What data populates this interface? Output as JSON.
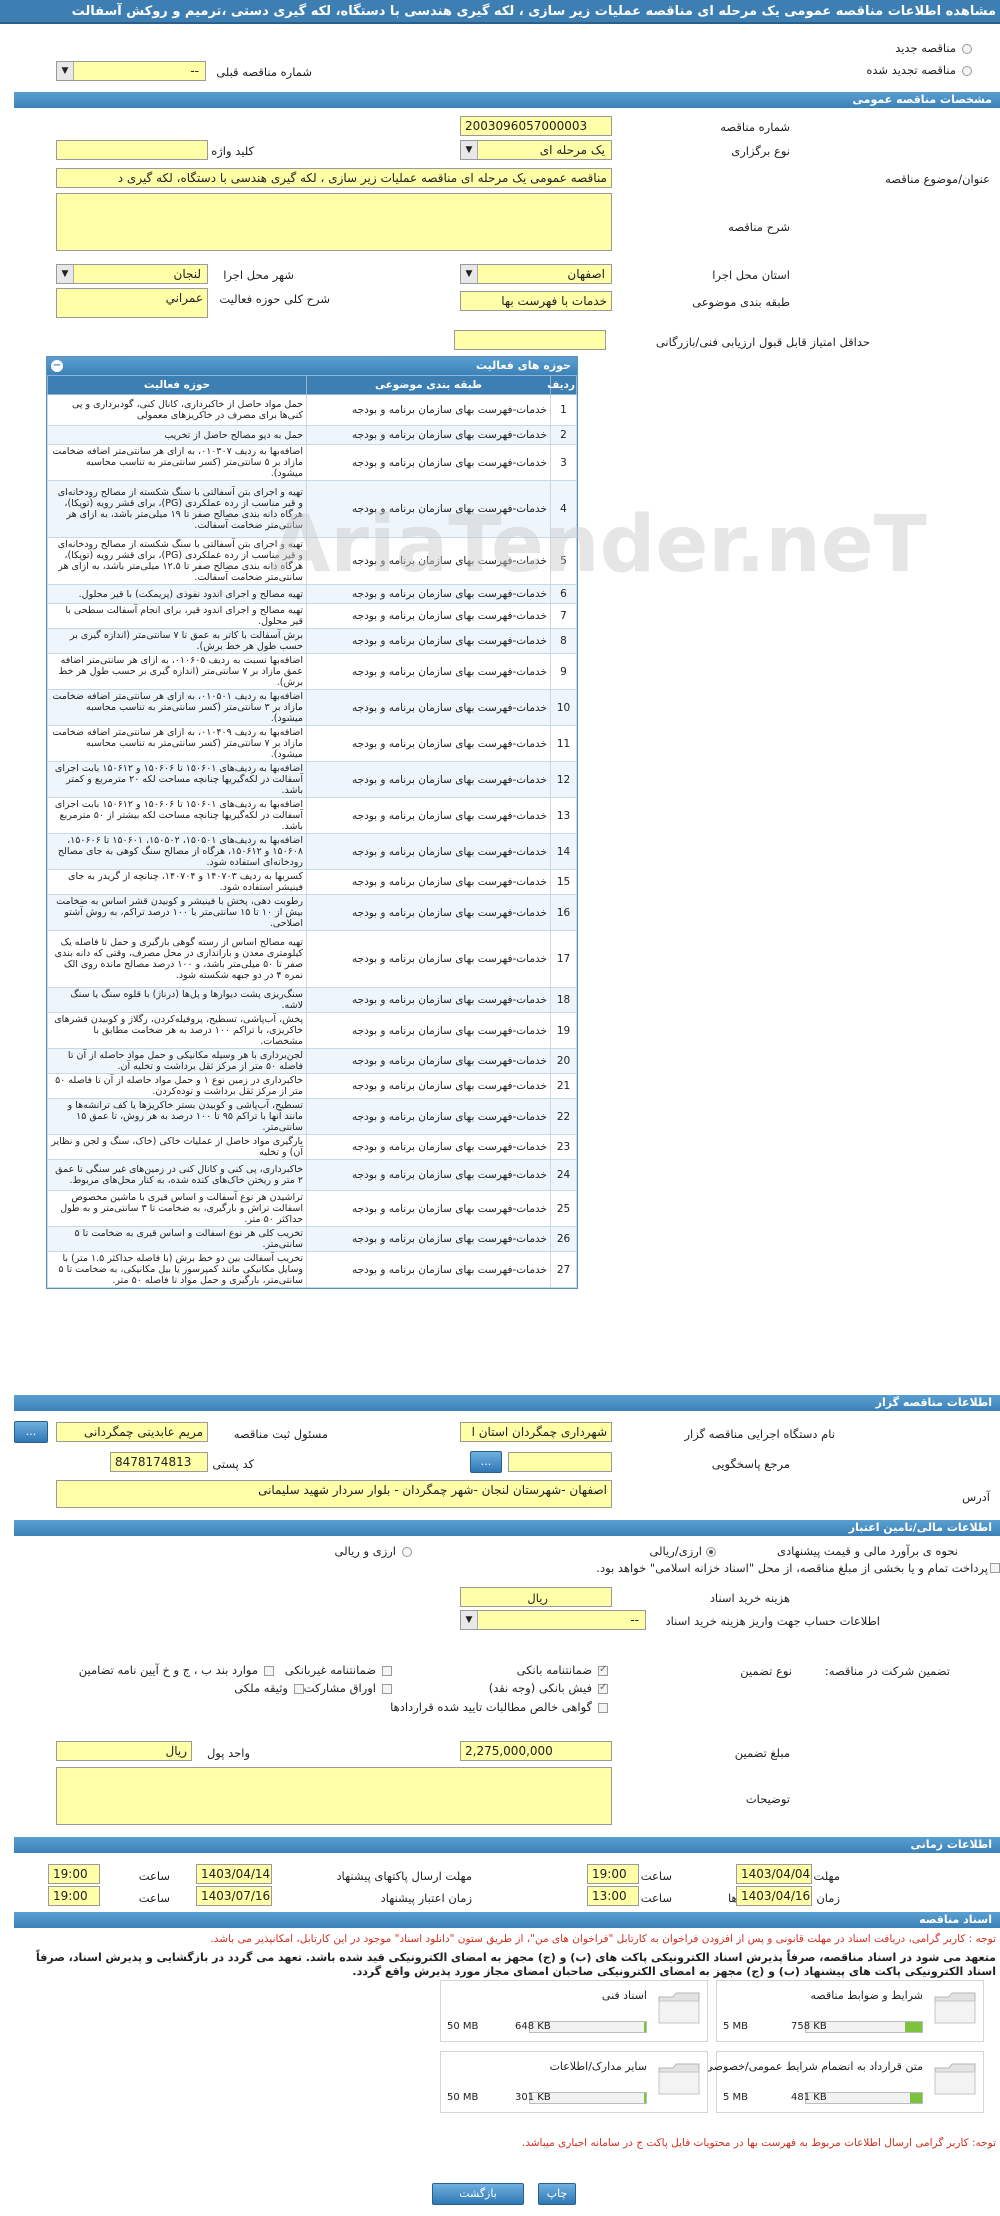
{
  "window": {
    "title": "مشاهده اطلاعات مناقصه عمومی یک مرحله ای مناقصه عملیات زیر سازی ، لکه گیری هندسی با دستگاه، لکه گیری دستی ،ترمیم و روکش آسفالت"
  },
  "top": {
    "new_tender": "مناقصه جدید",
    "renewed_tender": "مناقصه تجدید شده",
    "prev_tender_label": "شماره مناقصه قبلی",
    "prev_tender_value": "--"
  },
  "sections": {
    "general": "مشخصات مناقصه عمومی",
    "organizer": "اطلاعات مناقصه گزار",
    "financial": "اطلاعات مالی/تامین اعتبار",
    "timing": "اطلاعات زمانی",
    "documents": "اسناد مناقصه"
  },
  "general": {
    "number_label": "شماره مناقصه",
    "number_value": "2003096057000003",
    "holding_type_label": "نوع برگزاری",
    "holding_type_value": "یک مرحله ای",
    "keyword_label": "کلید واژه",
    "keyword_value": "",
    "subject_label": "عنوان/موضوع مناقصه",
    "subject_value": "مناقصه عمومی یک مرحله ای مناقصه عملیات زیر سازی ، لکه گیری هندسی با دستگاه، لکه گیری د",
    "description_label": "شرح مناقصه",
    "description_value": "",
    "province_label": "استان محل اجرا",
    "province_value": "اصفهان",
    "city_label": "شهر محل اجرا",
    "city_value": "لنجان",
    "category_label": "طبقه بندی موضوعی",
    "category_value": "خدمات با فهرست بها",
    "activity_label": "شرح کلی حوزه فعالیت",
    "activity_value": "عمراني",
    "min_score_label": "حداقل امتیاز قابل قبول ارزیابی فنی/بازرگانی",
    "min_score_value": ""
  },
  "activities": {
    "title": "حوزه های فعالیت",
    "headers": [
      "ردیف",
      "طبقه بندی موضوعی",
      "حوزه فعالیت"
    ],
    "rows": [
      [
        "1",
        "خدمات-فهرست بهای سازمان برنامه و بودجه",
        "حمل مواد حاصل از خاکبرداری، کانال کنی، گودبرداری و پی کنی‌ها برای مصرف در خاکریزهای معمولی"
      ],
      [
        "2",
        "خدمات-فهرست بهای سازمان برنامه و بودجه",
        "حمل به دپو مصالح حاصل از تخریب"
      ],
      [
        "3",
        "خدمات-فهرست بهای سازمان برنامه و بودجه",
        "اضافه‌بها به ردیف ۰۱۰۳۰۷، به ازای هر سانتی‌متر اضافه ضخامت مازاد بر ۵ سانتی‌متر (کسر سانتی‌متر به تناسب محاسبه میشود)."
      ],
      [
        "4",
        "خدمات-فهرست بهای سازمان برنامه و بودجه",
        "تهیه و اجرای بتن آسفالتی با سنگ شکسته از مصالح رودخانه‌ای و قیر مناسب از رده عملکردی (PG)، برای قشر رویه (توپکا)، هرگاه دانه بندی مصالح صفر تا ۱۹ میلی‌متر باشد، به ازای هر سانتی‌متر ضخامت آسفالت."
      ],
      [
        "5",
        "خدمات-فهرست بهای سازمان برنامه و بودجه",
        "تهیه و اجرای بتن آسفالتی با سنگ شکسته از مصالح رودخانه‌ای و قیر مناسب از رده عملکردی (PG)، برای قشر رویه (توپکا)، هرگاه دانه بندی مصالح صفر تا ۱۲.۵ میلی‌متر باشد، به ازای هر سانتی‌متر ضخامت آسفالت."
      ],
      [
        "6",
        "خدمات-فهرست بهای سازمان برنامه و بودجه",
        "تهیه مصالح و اجرای اندود نفوذی (پریمکت) با قیر محلول."
      ],
      [
        "7",
        "خدمات-فهرست بهای سازمان برنامه و بودجه",
        "تهیه مصالح و اجرای اندود قیر، برای انجام آسفالت سطحی با قیر محلول."
      ],
      [
        "8",
        "خدمات-فهرست بهای سازمان برنامه و بودجه",
        "برش آسفالت با کاتر به عمق تا ۷ سانتی‌متر (اندازه گیری بر حسب طول هر خط برش)."
      ],
      [
        "9",
        "خدمات-فهرست بهای سازمان برنامه و بودجه",
        "اضافه‌بها نسبت به ردیف ۰۱۰۶۰۵، به ازای هر سانتی‌متر اضافه عمق مازاد بر ۷ سانتی‌متر (اندازه گیری بر حسب طول هر خط برش)."
      ],
      [
        "10",
        "خدمات-فهرست بهای سازمان برنامه و بودجه",
        "اضافه‌بها به ردیف ۰۱۰۵۰۱، به ازای هر سانتی‌متر اضافه ضخامت مازاد بر ۳ سانتی‌متر (کسر سانتی‌متر به تناسب محاسبه میشود)."
      ],
      [
        "11",
        "خدمات-فهرست بهای سازمان برنامه و بودجه",
        "اضافه‌بها به ردیف ۰۱۰۴۰۹، به ازای هر سانتی‌متر اضافه ضخامت مازاد بر ۷ سانتی‌متر (کسر سانتی‌متر به تناسب محاسبه میشود)."
      ],
      [
        "12",
        "خدمات-فهرست بهای سازمان برنامه و بودجه",
        "اضافه‌بها به ردیف‌های ۱۵۰۶۰۱ تا ۱۵۰۶۰۶ و ۱۵۰۶۱۲ بابت اجرای آسفالت در لکه‌گیریها چنانچه مساحت لکه ۲۰ مترمربع و کمتر باشد."
      ],
      [
        "13",
        "خدمات-فهرست بهای سازمان برنامه و بودجه",
        "اضافه‌بها به ردیف‌های ۱۵۰۶۰۱ تا ۱۵۰۶۰۶ و ۱۵۰۶۱۲ بابت اجرای آسفالت در لکه‌گیریها چنانچه مساحت لکه بیشتر از ۵۰ مترمربع باشد."
      ],
      [
        "14",
        "خدمات-فهرست بهای سازمان برنامه و بودجه",
        "اضافه‌بها به ردیف‌های ۱۵۰۵۰۱، ۱۵۰۵۰۲، ۱۵۰۶۰۱ تا ۱۵۰۶۰۶، ۱۵۰۶۰۸ و ۱۵۰۶۱۲، هرگاه از مصالح سنگ کوهی به جای مصالح رودخانه‌ای استفاده شود."
      ],
      [
        "15",
        "خدمات-فهرست بهای سازمان برنامه و بودجه",
        "کسربها به ردیف ۱۴۰۷۰۳ و ۱۴۰۷۰۴، چنانچه از گریدر به جای فینیشر استفاده شود."
      ],
      [
        "16",
        "خدمات-فهرست بهای سازمان برنامه و بودجه",
        "رطوبت دهی، پخش با فینیشر و کوبیدن قشر اساس به ضخامت بیش از ۱۰ تا ۱۵ سانتی‌متر با ۱۰۰ درصد تراکم، به روش آشتو اصلاحی."
      ],
      [
        "17",
        "خدمات-فهرست بهای سازمان برنامه و بودجه",
        "تهیه مصالح اساس از رسته گوهی بارگیری و حمل تا فاصله یک کیلومتری معدن و باراندازی در محل مصرف، وقتی که دانه بندی صفر تا ۵۰ میلی‌متر باشد، و ۱۰۰ درصد مصالح مانده روی الک نمره ۴ در دو جبهه شکسته شود."
      ],
      [
        "18",
        "خدمات-فهرست بهای سازمان برنامه و بودجه",
        "سنگ‌ریزی پشت دیوارها و پل‌ها (درناژ) با قلوه سنگ یا سنگ لاشه."
      ],
      [
        "19",
        "خدمات-فهرست بهای سازمان برنامه و بودجه",
        "پخش، آب‌پاشی، تسطیح، پروفیله‌کردن، رگلاژ و کوبیدن قشرهای خاکریزی، با تراکم ۱۰۰ درصد به هر ضخامت مطابق با مشخصات."
      ],
      [
        "20",
        "خدمات-فهرست بهای سازمان برنامه و بودجه",
        "لجن‌برداری با هر وسیله مکانیکی و حمل مواد حاصله از آن تا فاصله ۵۰ متر از مرکز ثقل برداشت و تخلیه آن."
      ],
      [
        "21",
        "خدمات-فهرست بهای سازمان برنامه و بودجه",
        "خاکبرداری در زمین نوع ۱ و حمل مواد حاصله از آن تا فاصله ۵۰ متر از مرکز ثقل برداشت و توده‌کردن."
      ],
      [
        "22",
        "خدمات-فهرست بهای سازمان برنامه و بودجه",
        "تسطیح، آب‌پاشی و کوبیدن بستر خاکریزها یا کف ترانشه‌ها و مانند آنها با تراکم ۹۵ تا ۱۰۰ درصد به هر روش، تا عمق ۱۵ سانتی‌متر."
      ],
      [
        "23",
        "خدمات-فهرست بهای سازمان برنامه و بودجه",
        "بارگیری مواد حاصل از عملیات خاکی (خاک، سنگ و لجن و نظایر آن) و تخلیه"
      ],
      [
        "24",
        "خدمات-فهرست بهای سازمان برنامه و بودجه",
        "خاکبرداری، پی کنی و کانال کنی در زمین‌های غیر سنگی تا عمق ۲ متر و ریختن خاک‌های کنده شده، به کنار محل‌های مربوط."
      ],
      [
        "25",
        "خدمات-فهرست بهای سازمان برنامه و بودجه",
        "تراشیدن هر نوع آسفالت و اساس قیری با ماشین مخصوص اسفالت تراش و بارگیری، به ضخامت تا ۳ سانتی‌متر و به طول حداکثر ۵۰ متر."
      ],
      [
        "26",
        "خدمات-فهرست بهای سازمان برنامه و بودجه",
        "تخریب کلی هر نوع اسفالت و اساس قیری به ضخامت تا ۵ سانتی‌متر."
      ],
      [
        "27",
        "خدمات-فهرست بهای سازمان برنامه و بودجه",
        "تخریب آسفالت بین دو خط برش (با فاصله حداکثر ۱.۵ متر) با وسایل مکانیکی مانند کمپرسور یا بیل مکانیکی، به ضخامت تا ۵ سانتی‌متر، بارگیری و حمل مواد تا فاصله ۵۰ متر."
      ]
    ]
  },
  "organizer": {
    "agency_label": "نام دستگاه اجرایی مناقصه گزار",
    "agency_value": "شهرداری چمگردان استان ا",
    "registrar_label": "مسئول ثبت مناقصه",
    "registrar_value": "مریم عابدینی چمگردانی",
    "reference_label": "مرجع پاسخگویی",
    "reference_value": "",
    "postal_label": "کد پستی",
    "postal_value": "8478174813",
    "address_label": "آدرس",
    "address_value": "اصفهان -شهرستان لنجان -شهر چمگردان - بلوار سردار شهید سلیمانی",
    "dots": "..."
  },
  "financial": {
    "estimate_label": "نحوه ی برآورد مالی و قیمت پیشنهادی",
    "opt_currency": "ارزی/ریالی",
    "opt_currency2": "ارزی و ریالی",
    "payment_note": "پرداخت تمام و یا بخشی از مبلغ مناقصه، از محل \"اسناد خزانه اسلامی\" خواهد بود.",
    "doc_cost_label": "هزینه خرید اسناد",
    "doc_cost_value": "",
    "doc_cost_unit": "ریال",
    "account_label": "اطلاعات حساب جهت واریز هزینه خرید اسناد",
    "account_value": "--",
    "guarantee_label": "تضمین شرکت در مناقصه:",
    "guarantee_type_label": "نوع تضمین",
    "g_bank": "ضمانتنامه بانکی",
    "g_nonbank": "ضمانتنامه غیربانکی",
    "g_items": "موارد بند ب ، ج و خ آیین نامه تضامین",
    "g_cheque": "فیش بانکی (وجه نقد)",
    "g_bonds": "اوراق مشارکت",
    "g_property": "وثیقه ملکی",
    "g_claims": "گواهی خالص مطالبات تایید شده قراردادها",
    "amount_label": "مبلغ تضمین",
    "amount_value": "2,275,000,000",
    "currency_label": "واحد پول",
    "currency_value": "ریال",
    "notes_label": "توضیحات",
    "notes_value": ""
  },
  "timing": {
    "receive_deadline_label": "مهلت دریافت اسناد",
    "receive_deadline_date": "1403/04/04",
    "receive_deadline_time": "19:00",
    "submit_deadline_label": "مهلت ارسال پاکتهای پیشنهاد",
    "submit_deadline_date": "1403/04/14",
    "submit_deadline_time": "19:00",
    "opening_label": "زمان بازگشایی پاکت ها",
    "opening_date": "1403/04/16",
    "opening_time": "13:00",
    "validity_label": "زمان اعتبار پیشنهاد",
    "validity_date": "1403/07/16",
    "validity_time": "19:00",
    "time_label": "ساعت"
  },
  "documents": {
    "note1": "توجه : کاربر گرامی، دریافت اسناد در مهلت قانونی و پس از افزودن فراخوان به کارتابل \"فراخوان های من\"، از طریق ستون \"دانلود اسناد\" موجود در این کارتابل، امکانپذیر می باشد.",
    "note2": "متعهد می شود در اسناد مناقصه، صرفاً پذیرش اسناد الکترونیکی پاکت های (ب) و (ج) مجهز به امضای الکترونیکی قید شده باشد. تعهد می گردد در بازگشایی و پذیرش اسناد، صرفاً اسناد الکترونیکی پاکت های پیشنهاد (ب) و (ج) مجهز به امضای الکترونیکی صاحبان امضای مجاز مورد پذیرش واقع گردد.",
    "items": [
      {
        "title": "شرایط و ضوابط مناقصه",
        "size": "758 KB",
        "max": "5 MB",
        "fill": 0.15
      },
      {
        "title": "اسناد فنی",
        "size": "648 KB",
        "max": "50 MB",
        "fill": 0.02
      },
      {
        "title": "متن قرارداد به انضمام شرایط عمومی/خصوصی",
        "size": "481 KB",
        "max": "5 MB",
        "fill": 0.1
      },
      {
        "title": "سایر مدارک/اطلاعات",
        "size": "301 KB",
        "max": "50 MB",
        "fill": 0.01
      }
    ],
    "note3": "توجه: کاربر گرامی ارسال اطلاعات مربوط به فهرست بها در محتویات فایل پاکت ج در سامانه اجباری میباشد."
  },
  "footer": {
    "print": "چاپ",
    "back": "بازگشت"
  },
  "watermark": "AriaTender.neT"
}
